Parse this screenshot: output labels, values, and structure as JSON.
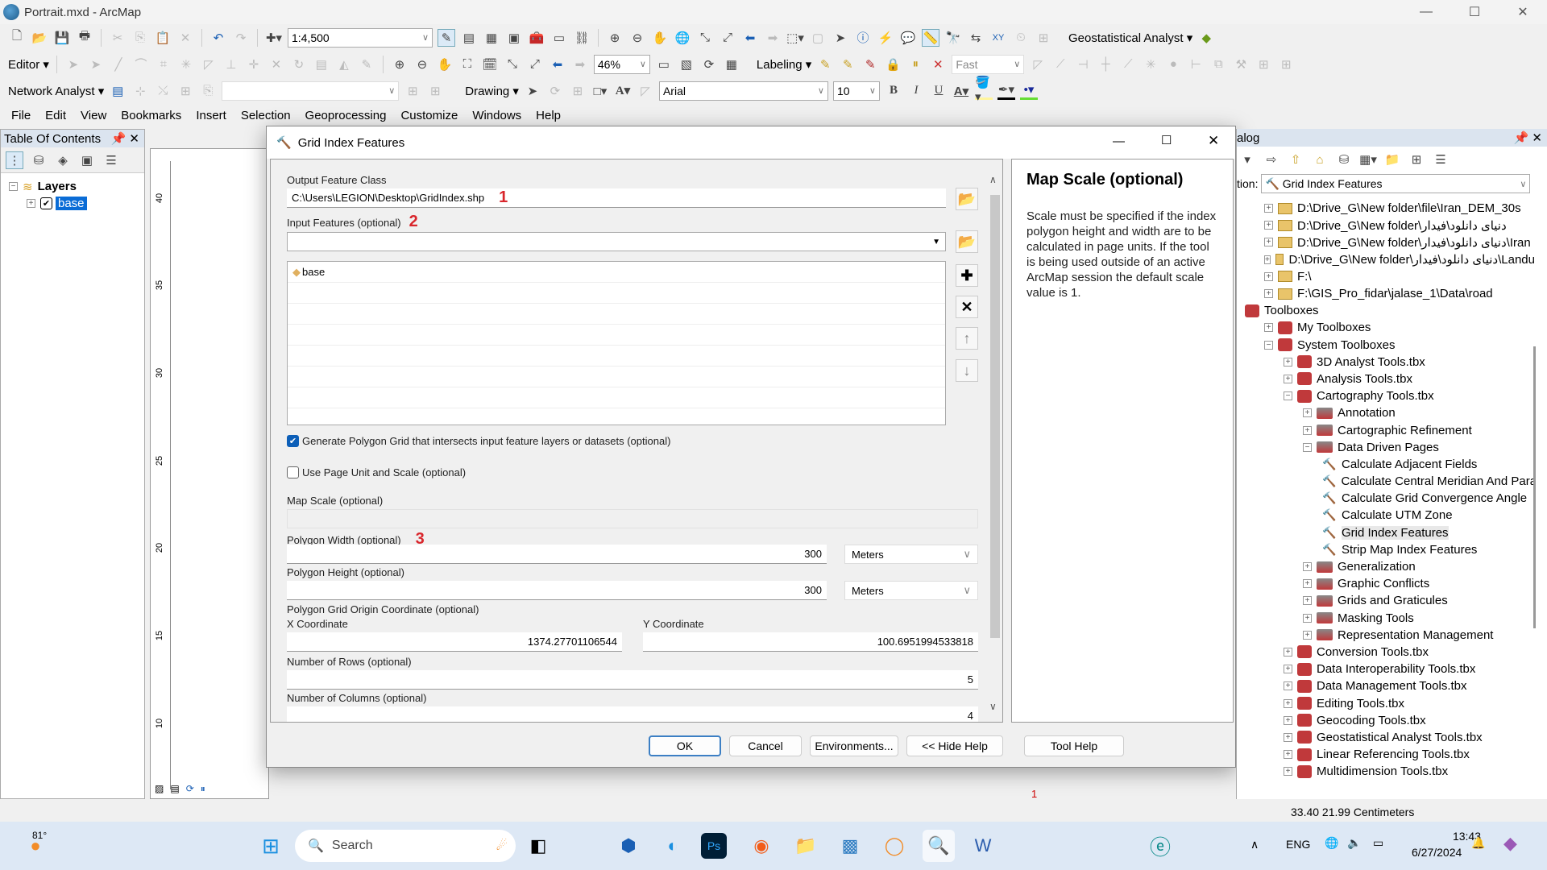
{
  "window": {
    "title": "Portrait.mxd - ArcMap",
    "minimize": "—",
    "maximize": "☐",
    "close": "✕"
  },
  "toolbars": {
    "scale": "1:4,500",
    "zoom_percent": "46%",
    "editor": "Editor ▾",
    "labeling": "Labeling ▾",
    "label_quality": "Fast",
    "geostatistical": "Geostatistical Analyst ▾",
    "network_analyst": "Network Analyst ▾",
    "drawing": "Drawing ▾",
    "font": "Arial",
    "font_size": "10",
    "bold": "B",
    "italic": "I",
    "underline": "U"
  },
  "menu": [
    "File",
    "Edit",
    "View",
    "Bookmarks",
    "Insert",
    "Selection",
    "Geoprocessing",
    "Customize",
    "Windows",
    "Help"
  ],
  "toc": {
    "title": "Table Of Contents",
    "root": "Layers",
    "layers": [
      {
        "name": "base",
        "checked": true,
        "selected": true
      }
    ]
  },
  "ruler": {
    "ticks": [
      "40",
      "35",
      "30",
      "25",
      "20",
      "15",
      "10"
    ]
  },
  "dialog": {
    "title": "Grid Index Features",
    "output_label": "Output Feature Class",
    "output_value": "C:\\Users\\LEGION\\Desktop\\GridIndex.shp",
    "annotation_1": "1",
    "input_label": "Input Features (optional)",
    "annotation_2": "2",
    "input_value": "",
    "input_list": [
      "base"
    ],
    "generate_label": "Generate Polygon Grid that intersects input feature layers or datasets (optional)",
    "generate_checked": true,
    "use_page_label": "Use Page Unit and Scale (optional)",
    "use_page_checked": false,
    "map_scale_label": "Map Scale (optional)",
    "map_scale_value": "",
    "width_label": "Polygon Width (optional)",
    "annotation_3": "3",
    "width_value": "300",
    "width_unit": "Meters",
    "height_label": "Polygon Height (optional)",
    "height_value": "300",
    "height_unit": "Meters",
    "origin_label": "Polygon Grid Origin Coordinate (optional)",
    "x_label": "X Coordinate",
    "x_value": "1374.27701106544",
    "y_label": "Y Coordinate",
    "y_value": "100.6951994533818",
    "rows_label": "Number of Rows (optional)",
    "rows_value": "5",
    "cols_label": "Number of Columns (optional)",
    "cols_value": "4",
    "buttons": {
      "ok": "OK",
      "cancel": "Cancel",
      "env": "Environments...",
      "hide_help": "<< Hide Help",
      "tool_help": "Tool Help"
    },
    "help_title": "Map Scale (optional)",
    "help_text": "Scale must be specified if the index polygon height and width are to be calculated in page units. If the tool is being used outside of an active ArcMap session the default scale value is 1."
  },
  "catalog": {
    "title": "alog",
    "location_label": "tion:",
    "location_value": "Grid Index Features",
    "items": [
      {
        "label": "D:\\Drive_G\\New folder\\file\\Iran_DEM_30s",
        "type": "folder",
        "level": 0,
        "exp": "+"
      },
      {
        "label": "D:\\Drive_G\\New folder\\دنیای دانلود\\فیدار",
        "type": "folder",
        "level": 0,
        "exp": "+"
      },
      {
        "label": "D:\\Drive_G\\New folder\\دنیای دانلود\\فیدار\\Iran",
        "type": "folder",
        "level": 0,
        "exp": "+"
      },
      {
        "label": "D:\\Drive_G\\New folder\\دنیای دانلود\\فیدار\\Landu",
        "type": "folder",
        "level": 0,
        "exp": "+"
      },
      {
        "label": "F:\\",
        "type": "folder",
        "level": 0,
        "exp": "+"
      },
      {
        "label": "F:\\GIS_Pro_fidar\\jalase_1\\Data\\road",
        "type": "folder",
        "level": 0,
        "exp": "+"
      },
      {
        "label": "Toolboxes",
        "type": "tbx",
        "level": -1,
        "exp": ""
      },
      {
        "label": "My Toolboxes",
        "type": "tbx",
        "level": 0,
        "exp": "+"
      },
      {
        "label": "System Toolboxes",
        "type": "tbx",
        "level": 0,
        "exp": "−"
      },
      {
        "label": "3D Analyst Tools.tbx",
        "type": "tbx",
        "level": 1,
        "exp": "+"
      },
      {
        "label": "Analysis Tools.tbx",
        "type": "tbx",
        "level": 1,
        "exp": "+"
      },
      {
        "label": "Cartography Tools.tbx",
        "type": "tbx",
        "level": 1,
        "exp": "−"
      },
      {
        "label": "Annotation",
        "type": "set",
        "level": 2,
        "exp": "+"
      },
      {
        "label": "Cartographic Refinement",
        "type": "set",
        "level": 2,
        "exp": "+"
      },
      {
        "label": "Data Driven Pages",
        "type": "set",
        "level": 2,
        "exp": "−"
      },
      {
        "label": "Calculate Adjacent Fields",
        "type": "tool",
        "level": 3,
        "exp": ""
      },
      {
        "label": "Calculate Central Meridian And Para",
        "type": "tool",
        "level": 3,
        "exp": ""
      },
      {
        "label": "Calculate Grid Convergence Angle",
        "type": "tool",
        "level": 3,
        "exp": ""
      },
      {
        "label": "Calculate UTM Zone",
        "type": "tool",
        "level": 3,
        "exp": ""
      },
      {
        "label": "Grid Index Features",
        "type": "tool",
        "level": 3,
        "exp": "",
        "selected": true
      },
      {
        "label": "Strip Map Index Features",
        "type": "tool",
        "level": 3,
        "exp": ""
      },
      {
        "label": "Generalization",
        "type": "set",
        "level": 2,
        "exp": "+"
      },
      {
        "label": "Graphic Conflicts",
        "type": "set",
        "level": 2,
        "exp": "+"
      },
      {
        "label": "Grids and Graticules",
        "type": "set",
        "level": 2,
        "exp": "+"
      },
      {
        "label": "Masking Tools",
        "type": "set",
        "level": 2,
        "exp": "+"
      },
      {
        "label": "Representation Management",
        "type": "set",
        "level": 2,
        "exp": "+"
      },
      {
        "label": "Conversion Tools.tbx",
        "type": "tbx",
        "level": 1,
        "exp": "+"
      },
      {
        "label": "Data Interoperability Tools.tbx",
        "type": "tbx",
        "level": 1,
        "exp": "+"
      },
      {
        "label": "Data Management Tools.tbx",
        "type": "tbx",
        "level": 1,
        "exp": "+"
      },
      {
        "label": "Editing Tools.tbx",
        "type": "tbx",
        "level": 1,
        "exp": "+"
      },
      {
        "label": "Geocoding Tools.tbx",
        "type": "tbx",
        "level": 1,
        "exp": "+"
      },
      {
        "label": "Geostatistical Analyst Tools.tbx",
        "type": "tbx",
        "level": 1,
        "exp": "+"
      },
      {
        "label": "Linear Referencing Tools.tbx",
        "type": "tbx",
        "level": 1,
        "exp": "+"
      },
      {
        "label": "Multidimension Tools.tbx",
        "type": "tbx",
        "level": 1,
        "exp": "+"
      }
    ]
  },
  "status": {
    "coords": "33.40  21.99 Centimeters",
    "page": "1"
  },
  "taskbar": {
    "weather": "81°",
    "search_placeholder": "Search",
    "lang": "ENG",
    "time": "13:43",
    "date": "6/27/2024"
  }
}
